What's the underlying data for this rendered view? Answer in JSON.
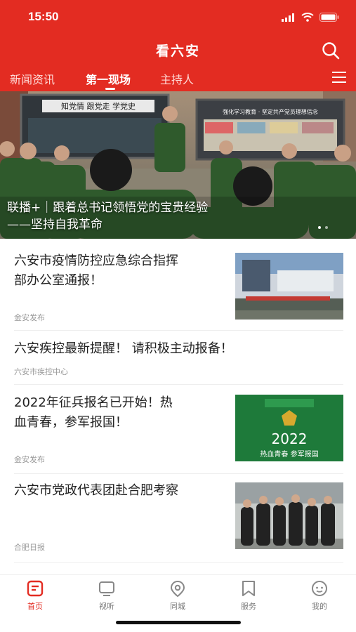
{
  "status": {
    "time": "15:50"
  },
  "app": {
    "title": "看六安"
  },
  "tabs": [
    {
      "label": "新闻资讯",
      "active": false
    },
    {
      "label": "第一现场",
      "active": true
    },
    {
      "label": "主持人",
      "active": false
    }
  ],
  "banner": {
    "caption_line1": "联播+｜跟着总书记领悟党的宝贵经验",
    "caption_line2": "——坚持自我革命",
    "board_left_text": "知党情 跟党走 学党史",
    "board_right_text": "强化学习教育 · 坚定共产党员理想信念"
  },
  "feed": [
    {
      "title_line1": "六安市疫情防控应急综合指挥",
      "title_line2": "部办公室通报！",
      "source": "金安发布",
      "thumb": "building-photo"
    },
    {
      "title_line1": "六安疾控最新提醒！ 请积极主动报备！",
      "source": "六安市疾控中心"
    },
    {
      "title_line1": "2022年征兵报名已开始！热",
      "title_line2": "血青春，参军报国！",
      "source": "金安发布",
      "thumb_year": "2022",
      "thumb_slogan": "热血青春 参军报国"
    },
    {
      "title_line1": "六安市党政代表团赴合肥考察",
      "source": "合肥日报",
      "thumb": "delegation-photo"
    }
  ],
  "bottom_nav": [
    {
      "label": "首页",
      "icon": "home-icon",
      "active": true
    },
    {
      "label": "视听",
      "icon": "tv-icon",
      "active": false
    },
    {
      "label": "同城",
      "icon": "location-icon",
      "active": false
    },
    {
      "label": "服务",
      "icon": "bookmark-icon",
      "active": false
    },
    {
      "label": "我的",
      "icon": "profile-icon",
      "active": false
    }
  ],
  "colors": {
    "brand_red": "#e32c22",
    "army_green": "#2f5a2c",
    "recruit_green": "#1e7a3a"
  }
}
